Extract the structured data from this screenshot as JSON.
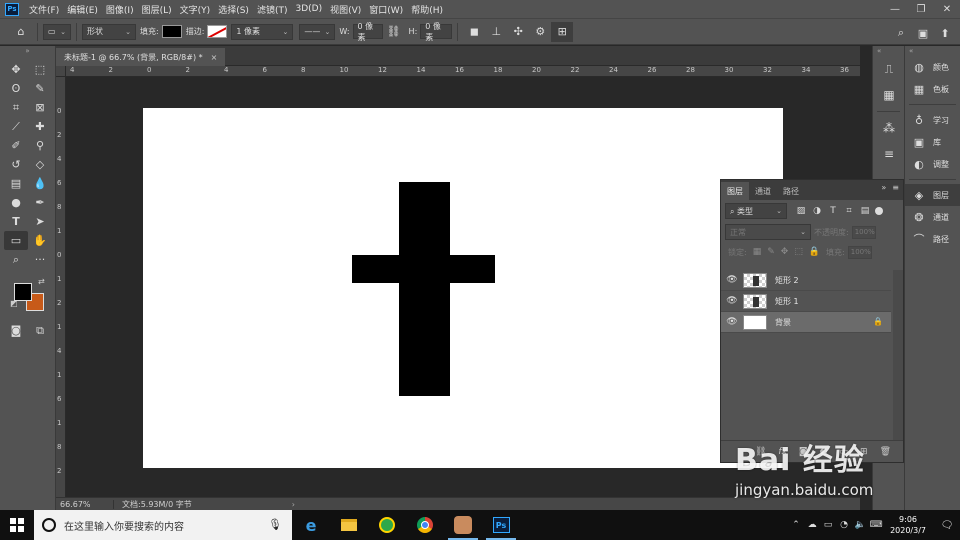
{
  "menubar": {
    "logo": "Ps",
    "items": [
      "文件(F)",
      "编辑(E)",
      "图像(I)",
      "图层(L)",
      "文字(Y)",
      "选择(S)",
      "滤镜(T)",
      "3D(D)",
      "视图(V)",
      "窗口(W)",
      "帮助(H)"
    ],
    "window_controls": [
      "—",
      "❐",
      "✕"
    ]
  },
  "options": {
    "mode": "形状",
    "fill_label": "填充:",
    "stroke_label": "描边:",
    "stroke_width": "1 像素",
    "w_label": "W:",
    "w_value": "0 像素",
    "h_label": "H:",
    "h_value": "0 像素"
  },
  "document": {
    "tab_title": "未标题-1 @ 66.7% (背景, RGB/8#) *",
    "tab_close": "×"
  },
  "rulers": {
    "top": [
      "4",
      "2",
      "0",
      "2",
      "4",
      "6",
      "8",
      "10",
      "12",
      "14",
      "16",
      "18",
      "20",
      "22",
      "24",
      "26",
      "28",
      "30",
      "32",
      "34",
      "36"
    ],
    "left": [
      "0",
      "2",
      "4",
      "6",
      "8",
      "1",
      "0",
      "1",
      "2",
      "1",
      "4",
      "1",
      "6",
      "1",
      "8",
      "2"
    ]
  },
  "status": {
    "zoom": "66.67%",
    "doc_info": "文档:5.93M/0 字节",
    "arrow": "›"
  },
  "right_strip": {
    "items": [
      {
        "icon": "palette-icon",
        "label": "颜色"
      },
      {
        "icon": "swatches-icon",
        "label": "色板"
      },
      {
        "icon": "learn-icon",
        "label": "学习"
      },
      {
        "icon": "library-icon",
        "label": "库"
      },
      {
        "icon": "adjustments-icon",
        "label": "调整"
      },
      {
        "icon": "layers-icon",
        "label": "图层"
      },
      {
        "icon": "channels-icon",
        "label": "通道"
      },
      {
        "icon": "paths-icon",
        "label": "路径"
      }
    ]
  },
  "layers_panel": {
    "tabs": [
      "图层",
      "通道",
      "路径"
    ],
    "filter_kind": "类型",
    "blend_mode": "正常",
    "opacity_label": "不透明度:",
    "opacity_value": "100%",
    "lock_label": "锁定:",
    "fill_label": "填充:",
    "fill_value": "100%",
    "layers": [
      {
        "name": "矩形 2",
        "type": "shape",
        "visible": true,
        "locked": false,
        "selected": false
      },
      {
        "name": "矩形 1",
        "type": "shape",
        "visible": true,
        "locked": false,
        "selected": false
      },
      {
        "name": "背景",
        "type": "background",
        "visible": true,
        "locked": true,
        "selected": true
      }
    ]
  },
  "watermark": {
    "logo_text": "Bai 经验",
    "url": "jingyan.baidu.com"
  },
  "taskbar": {
    "search_placeholder": "在这里输入你要搜索的内容",
    "time": "9:06",
    "date": "2020/3/7",
    "notification_count": "",
    "apps": [
      "edge-icon",
      "file-explorer-icon",
      "app-icon",
      "chrome-icon",
      "avatar-app-icon",
      "photoshop-icon"
    ]
  },
  "colors": {
    "foreground": "#000000",
    "background": "#c75a19",
    "accent": "#31a8ff"
  }
}
